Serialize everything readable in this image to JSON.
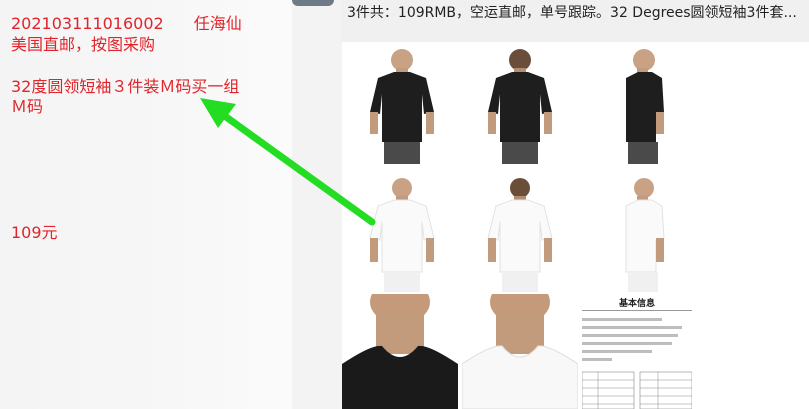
{
  "note": {
    "order_id": "202103111016002",
    "customer": "任海仙",
    "purchase_line": "美国直邮，按图采购",
    "product_line1": "32度圆领短袖３件装Ｍ码买一组",
    "product_line2": "Ｍ码",
    "price": "109元"
  },
  "chat": {
    "message": "3件共：109RMB，空运直邮，单号跟踪。32 Degrees圆领短袖3件套..."
  },
  "product_images": [
    {
      "name": "black-tshirt-front",
      "color": "#1e1e1e"
    },
    {
      "name": "black-tshirt-back",
      "color": "#1e1e1e"
    },
    {
      "name": "black-tshirt-side",
      "color": "#1e1e1e"
    },
    {
      "name": "white-tshirt-front",
      "color": "#fafafa"
    },
    {
      "name": "white-tshirt-back",
      "color": "#fafafa"
    },
    {
      "name": "white-tshirt-side",
      "color": "#fafafa"
    },
    {
      "name": "black-collar-closeup",
      "color": "#1e1e1e"
    },
    {
      "name": "white-collar-closeup",
      "color": "#fafafa"
    }
  ],
  "spec_sheet": {
    "title": "基本信息"
  },
  "colors": {
    "note_text": "#e0242a",
    "arrow": "#22dd22"
  }
}
